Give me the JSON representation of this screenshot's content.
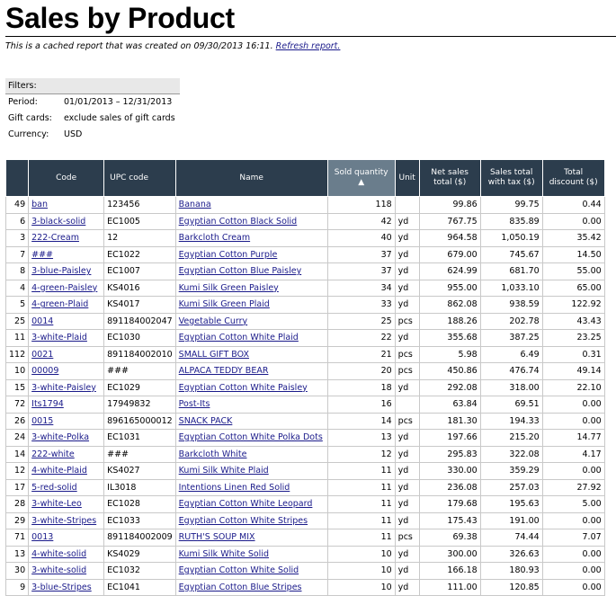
{
  "page": {
    "title": "Sales by Product",
    "cache_note": "This is a cached report that was created on 09/30/2013 16:11.",
    "refresh_link": "Refresh report."
  },
  "filters": {
    "heading": "Filters:",
    "rows": [
      {
        "label": "Period:",
        "value": "01/01/2013 – 12/31/2013"
      },
      {
        "label": "Gift cards:",
        "value": "exclude sales of gift cards"
      },
      {
        "label": "Currency:",
        "value": "USD"
      }
    ]
  },
  "table": {
    "headers": {
      "code": "Code",
      "upc": "UPC code",
      "name": "Name",
      "sold_qty": "Sold quantity ▲",
      "unit": "Unit",
      "net_sales": "Net sales total ($)",
      "sales_tax": "Sales total with tax ($)",
      "discount": "Total discount ($)"
    },
    "rows": [
      {
        "n": "49",
        "code": "ban",
        "upc": "123456",
        "name": "Banana",
        "qty": "118",
        "unit": "",
        "net": "99.86",
        "tax": "99.75",
        "disc": "0.44"
      },
      {
        "n": "6",
        "code": "3-black-solid",
        "upc": "EC1005",
        "name": "Egyptian Cotton Black Solid",
        "qty": "42",
        "unit": "yd",
        "net": "767.75",
        "tax": "835.89",
        "disc": "0.00"
      },
      {
        "n": "3",
        "code": "222-Cream",
        "upc": "12",
        "name": "Barkcloth Cream",
        "qty": "40",
        "unit": "yd",
        "net": "964.58",
        "tax": "1,050.19",
        "disc": "35.42"
      },
      {
        "n": "7",
        "code": "###",
        "upc": "EC1022",
        "name": "Egyptian Cotton Purple",
        "qty": "37",
        "unit": "yd",
        "net": "679.00",
        "tax": "745.67",
        "disc": "14.50"
      },
      {
        "n": "8",
        "code": "3-blue-Paisley",
        "upc": "EC1007",
        "name": "Egyptian Cotton Blue Paisley",
        "qty": "37",
        "unit": "yd",
        "net": "624.99",
        "tax": "681.70",
        "disc": "55.00"
      },
      {
        "n": "4",
        "code": "4-green-Paisley",
        "upc": "KS4016",
        "name": "Kumi Silk Green Paisley",
        "qty": "34",
        "unit": "yd",
        "net": "955.00",
        "tax": "1,033.10",
        "disc": "65.00"
      },
      {
        "n": "5",
        "code": "4-green-Plaid",
        "upc": "KS4017",
        "name": "Kumi Silk Green Plaid",
        "qty": "33",
        "unit": "yd",
        "net": "862.08",
        "tax": "938.59",
        "disc": "122.92"
      },
      {
        "n": "25",
        "code": "0014",
        "upc": "891184002047",
        "name": "Vegetable Curry",
        "qty": "25",
        "unit": "pcs",
        "net": "188.26",
        "tax": "202.78",
        "disc": "43.43"
      },
      {
        "n": "11",
        "code": "3-white-Plaid",
        "upc": "EC1030",
        "name": "Egyptian Cotton White Plaid",
        "qty": "22",
        "unit": "yd",
        "net": "355.68",
        "tax": "387.25",
        "disc": "23.25"
      },
      {
        "n": "112",
        "code": "0021",
        "upc": "891184002010",
        "name": "SMALL GIFT BOX",
        "qty": "21",
        "unit": "pcs",
        "net": "5.98",
        "tax": "6.49",
        "disc": "0.31"
      },
      {
        "n": "10",
        "code": "00009",
        "upc": "###",
        "name": "ALPACA TEDDY BEAR",
        "qty": "20",
        "unit": "pcs",
        "net": "450.86",
        "tax": "476.74",
        "disc": "49.14"
      },
      {
        "n": "15",
        "code": "3-white-Paisley",
        "upc": "EC1029",
        "name": "Egyptian Cotton White Paisley",
        "qty": "18",
        "unit": "yd",
        "net": "292.08",
        "tax": "318.00",
        "disc": "22.10"
      },
      {
        "n": "72",
        "code": "Its1794",
        "upc": "17949832",
        "name": "Post-Its",
        "qty": "16",
        "unit": "",
        "net": "63.84",
        "tax": "69.51",
        "disc": "0.00"
      },
      {
        "n": "26",
        "code": "0015",
        "upc": "896165000012",
        "name": "SNACK PACK",
        "qty": "14",
        "unit": "pcs",
        "net": "181.30",
        "tax": "194.33",
        "disc": "0.00"
      },
      {
        "n": "24",
        "code": "3-white-Polka",
        "upc": "EC1031",
        "name": "Egyptian Cotton White Polka Dots",
        "qty": "13",
        "unit": "yd",
        "net": "197.66",
        "tax": "215.20",
        "disc": "14.77"
      },
      {
        "n": "14",
        "code": "222-white",
        "upc": "###",
        "name": "Barkcloth White",
        "qty": "12",
        "unit": "yd",
        "net": "295.83",
        "tax": "322.08",
        "disc": "4.17"
      },
      {
        "n": "12",
        "code": "4-white-Plaid",
        "upc": "KS4027",
        "name": "Kumi Silk White Plaid",
        "qty": "11",
        "unit": "yd",
        "net": "330.00",
        "tax": "359.29",
        "disc": "0.00"
      },
      {
        "n": "17",
        "code": "5-red-solid",
        "upc": "IL3018",
        "name": "Intentions Linen Red Solid",
        "qty": "11",
        "unit": "yd",
        "net": "236.08",
        "tax": "257.03",
        "disc": "27.92"
      },
      {
        "n": "28",
        "code": "3-white-Leo",
        "upc": "EC1028",
        "name": "Egyptian Cotton White Leopard",
        "qty": "11",
        "unit": "yd",
        "net": "179.68",
        "tax": "195.63",
        "disc": "5.00"
      },
      {
        "n": "29",
        "code": "3-white-Stripes",
        "upc": "EC1033",
        "name": "Egyptian Cotton White Stripes",
        "qty": "11",
        "unit": "yd",
        "net": "175.43",
        "tax": "191.00",
        "disc": "0.00"
      },
      {
        "n": "71",
        "code": "0013",
        "upc": "891184002009",
        "name": "RUTH'S SOUP MIX",
        "qty": "11",
        "unit": "pcs",
        "net": "69.38",
        "tax": "74.44",
        "disc": "7.07"
      },
      {
        "n": "13",
        "code": "4-white-solid",
        "upc": "KS4029",
        "name": "Kumi Silk White Solid",
        "qty": "10",
        "unit": "yd",
        "net": "300.00",
        "tax": "326.63",
        "disc": "0.00"
      },
      {
        "n": "30",
        "code": "3-white-solid",
        "upc": "EC1032",
        "name": "Egyptian Cotton White Solid",
        "qty": "10",
        "unit": "yd",
        "net": "166.18",
        "tax": "180.93",
        "disc": "0.00"
      },
      {
        "n": "9",
        "code": "3-blue-Stripes",
        "upc": "EC1041",
        "name": "Egyptian Cotton Blue Stripes",
        "qty": "10",
        "unit": "yd",
        "net": "111.00",
        "tax": "120.85",
        "disc": "0.00"
      }
    ]
  }
}
